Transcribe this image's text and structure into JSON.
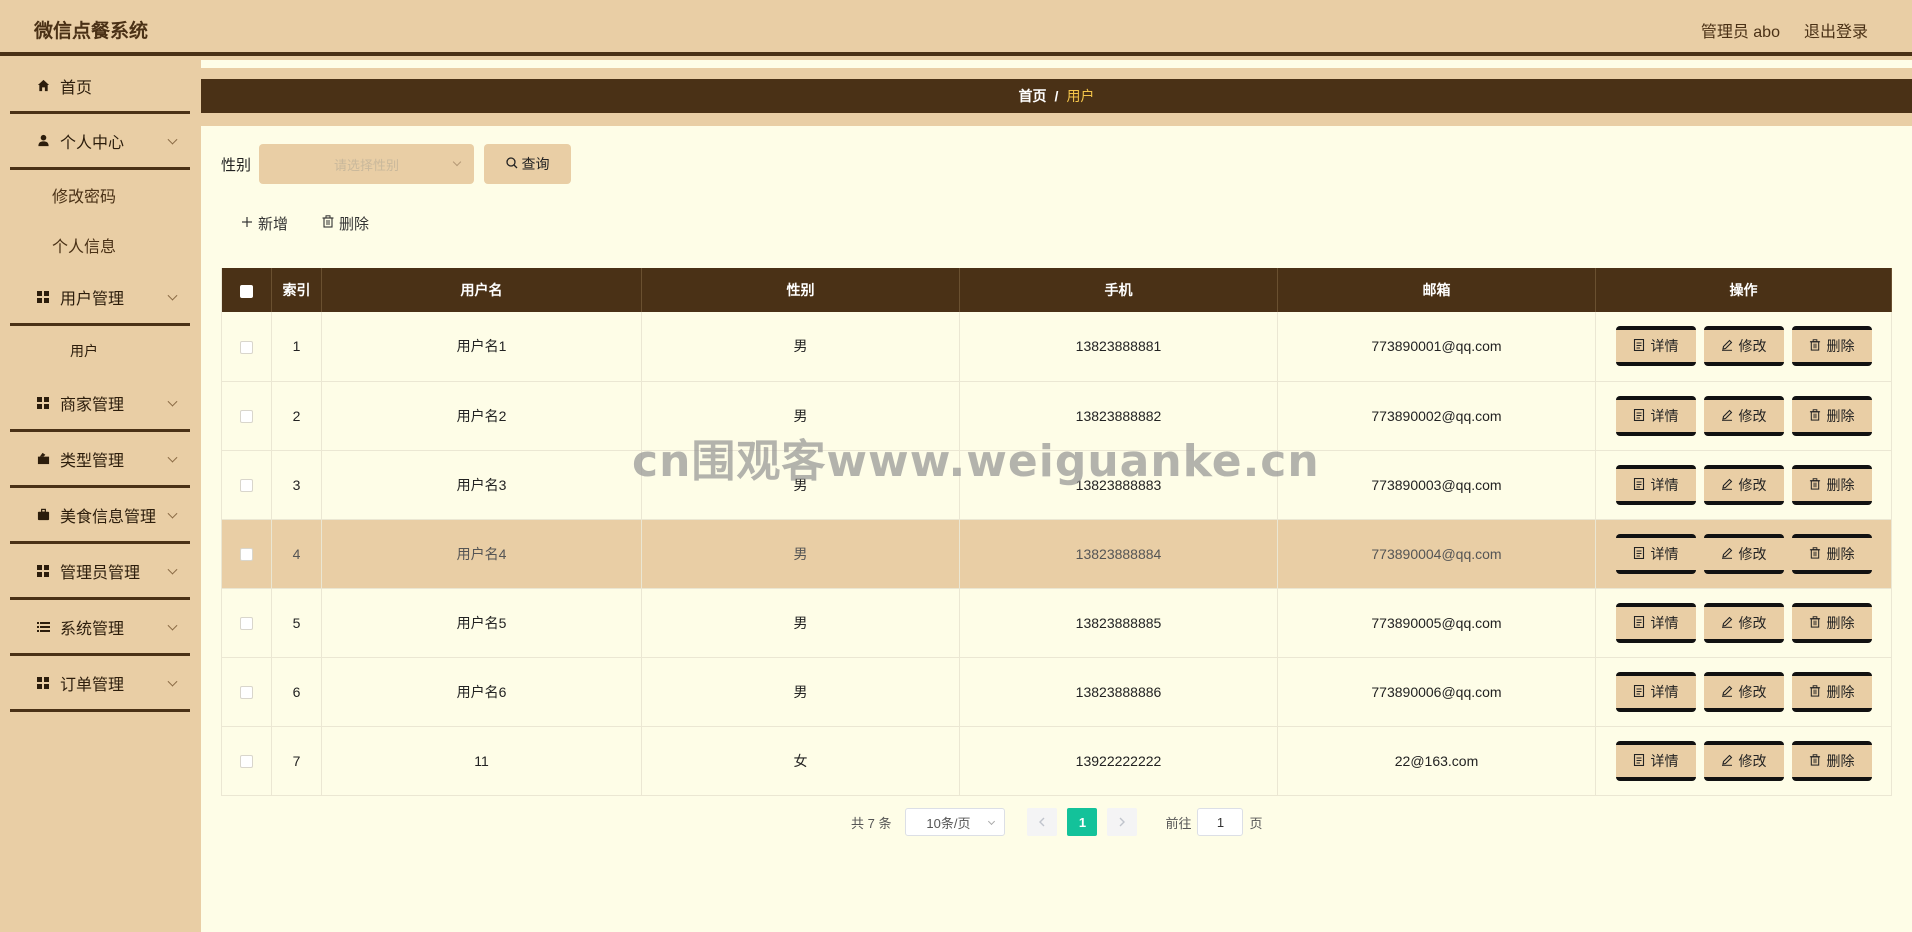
{
  "app": {
    "title": "微信点餐系统"
  },
  "header": {
    "user_label": "管理员 abo",
    "logout_label": "退出登录"
  },
  "sidebar": {
    "items": [
      {
        "label": "首页",
        "icon": "home-icon"
      },
      {
        "label": "个人中心",
        "icon": "user-icon",
        "expanded": true,
        "children": [
          "修改密码",
          "个人信息"
        ]
      },
      {
        "label": "用户管理",
        "icon": "grid-icon",
        "expanded": true,
        "children": [
          "用户"
        ]
      },
      {
        "label": "商家管理",
        "icon": "grid-icon"
      },
      {
        "label": "类型管理",
        "icon": "tag-icon"
      },
      {
        "label": "美食信息管理",
        "icon": "briefcase-icon"
      },
      {
        "label": "管理员管理",
        "icon": "grid-icon"
      },
      {
        "label": "系统管理",
        "icon": "list-icon"
      },
      {
        "label": "订单管理",
        "icon": "grid-icon"
      }
    ],
    "active_child": "用户"
  },
  "breadcrumb": {
    "home": "首页",
    "separator": "/",
    "current": "用户"
  },
  "search": {
    "label": "性别",
    "placeholder": "请选择性别",
    "query_label": "查询"
  },
  "actions": {
    "add_label": "新增",
    "delete_label": "删除"
  },
  "table": {
    "columns": [
      "索引",
      "用户名",
      "性别",
      "手机",
      "邮箱",
      "操作"
    ],
    "rows": [
      {
        "index": "1",
        "username": "用户名1",
        "gender": "男",
        "phone": "13823888881",
        "email": "773890001@qq.com"
      },
      {
        "index": "2",
        "username": "用户名2",
        "gender": "男",
        "phone": "13823888882",
        "email": "773890002@qq.com"
      },
      {
        "index": "3",
        "username": "用户名3",
        "gender": "男",
        "phone": "13823888883",
        "email": "773890003@qq.com"
      },
      {
        "index": "4",
        "username": "用户名4",
        "gender": "男",
        "phone": "13823888884",
        "email": "773890004@qq.com",
        "highlighted": true
      },
      {
        "index": "5",
        "username": "用户名5",
        "gender": "男",
        "phone": "13823888885",
        "email": "773890005@qq.com"
      },
      {
        "index": "6",
        "username": "用户名6",
        "gender": "男",
        "phone": "13823888886",
        "email": "773890006@qq.com"
      },
      {
        "index": "7",
        "username": "11",
        "gender": "女",
        "phone": "13922222222",
        "email": "22@163.com"
      }
    ],
    "row_actions": {
      "detail": "详情",
      "edit": "修改",
      "delete": "删除"
    }
  },
  "pagination": {
    "total_text": "共 7 条",
    "page_size": "10条/页",
    "current_page": "1",
    "goto_prefix": "前往",
    "goto_value": "1",
    "goto_suffix": "页"
  },
  "watermark": "cn围观客www.weiguanke.cn",
  "colors": {
    "sidebar_bg": "#e9cea5",
    "dark_brown": "#4a3116",
    "content_bg": "#fefde7",
    "accent_green": "#13c29a",
    "crumb_current": "#f3c44a"
  }
}
